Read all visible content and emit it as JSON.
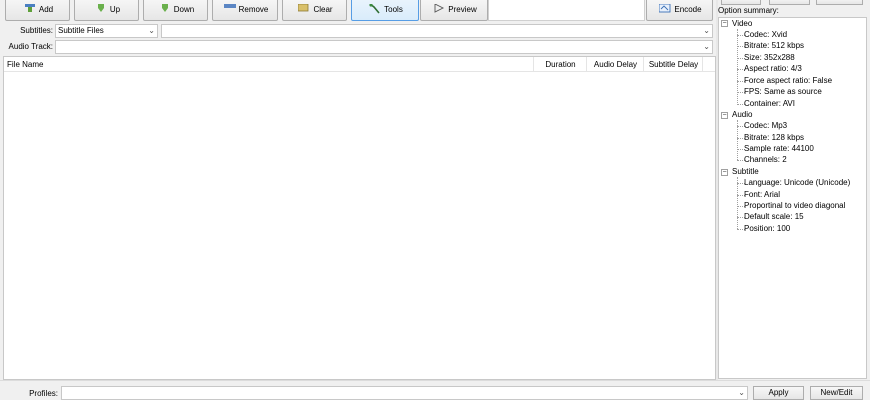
{
  "toolbar": {
    "add": "Add",
    "up": "Up",
    "down": "Down",
    "remove": "Remove",
    "clear": "Clear",
    "tools": "Tools",
    "preview": "Preview",
    "encode": "Encode"
  },
  "subtitles": {
    "label": "Subtitles:",
    "type_value": "Subtitle Files",
    "file_value": ""
  },
  "audio": {
    "label": "Audio Track:",
    "value": ""
  },
  "file_list": {
    "columns": [
      "File Name",
      "Duration",
      "Audio Delay",
      "Subtitle Delay"
    ]
  },
  "options": {
    "title": "Option summary:",
    "video": {
      "label": "Video",
      "items": [
        "Codec: Xvid",
        "Bitrate: 512 kbps",
        "Size: 352x288",
        "Aspect ratio: 4/3",
        "Force aspect ratio: False",
        "FPS: Same as source",
        "Container: AVI"
      ]
    },
    "audio": {
      "label": "Audio",
      "items": [
        "Codec: Mp3",
        "Bitrate: 128 kbps",
        "Sample rate: 44100",
        "Channels: 2"
      ]
    },
    "subtitle": {
      "label": "Subtitle",
      "items": [
        "Language: Unicode (Unicode)",
        "Font: Arial",
        "Proportinal to video diagonal",
        "Default scale: 15",
        "Position: 100"
      ]
    }
  },
  "profiles": {
    "label": "Profiles:",
    "value": "",
    "apply": "Apply",
    "new_edit": "New/Edit"
  },
  "colors": {
    "accent": "#569de5",
    "window_bg": "#f0f0f0"
  }
}
